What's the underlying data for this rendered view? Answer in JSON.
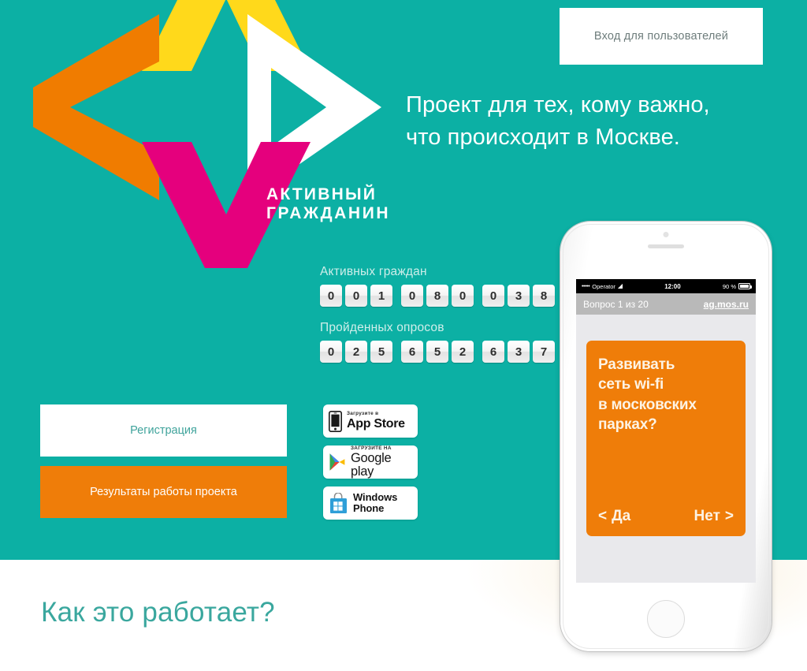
{
  "theme": {
    "teal": "#0cb0a4",
    "orange": "#ef7d09",
    "yellow": "#ffd91b",
    "magenta": "#e5007d",
    "white": "#ffffff"
  },
  "header": {
    "login_label": "Вход для пользователей"
  },
  "logo": {
    "word_line1": "АКТИВНЫЙ",
    "word_line2": "ГРАЖДАНИН"
  },
  "hero": {
    "tagline_line1": "Проект для тех, кому важно,",
    "tagline_line2": "что происходит в Москве."
  },
  "counters": [
    {
      "label": "Активных граждан",
      "groups": [
        [
          "0",
          "0",
          "1"
        ],
        [
          "0",
          "8",
          "0"
        ],
        [
          "0",
          "3",
          "8"
        ]
      ],
      "value": "001080038"
    },
    {
      "label": "Пройденных опросов",
      "groups": [
        [
          "0",
          "2",
          "5"
        ],
        [
          "6",
          "5",
          "2"
        ],
        [
          "6",
          "3",
          "7"
        ]
      ],
      "value": "025652637"
    }
  ],
  "cta": {
    "register_label": "Регистрация",
    "results_label": "Результаты работы проекта"
  },
  "store_badges": [
    {
      "icon": "apple-iphone-icon",
      "top_text": "Загрузите в",
      "main_text": "App Store",
      "name": "app-store-badge"
    },
    {
      "icon": "google-play-icon",
      "top_text": "ЗАГРУЗИТЕ НА",
      "main_text": "Google play",
      "name": "google-play-badge"
    },
    {
      "icon": "windows-store-icon",
      "top_text": "",
      "main_text_line1": "Windows",
      "main_text_line2": "Phone",
      "name": "windows-phone-badge"
    }
  ],
  "phone": {
    "status_bar": {
      "dots": "•••••",
      "carrier": "Operator",
      "time": "12:00",
      "battery": "90 %"
    },
    "nav_bar": {
      "question_progress": "Вопрос 1 из 20",
      "url": "ag.mos.ru"
    },
    "question": {
      "line1": "Развивать",
      "line2": "сеть wi-fi",
      "line3": "в московских",
      "line4": "парках?",
      "answer_yes": "Да",
      "answer_no": "Нет",
      "chevron_left": "<",
      "chevron_right": ">"
    }
  },
  "sections": {
    "how_it_works_heading": "Как это работает?"
  }
}
